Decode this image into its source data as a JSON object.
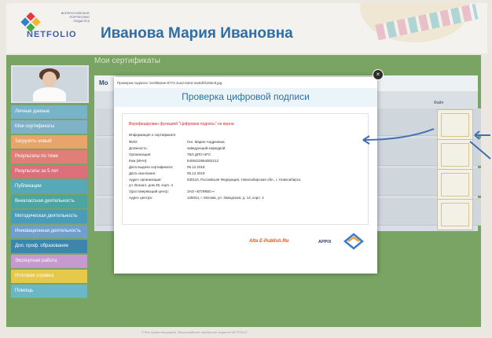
{
  "header": {
    "logo_line1": "ВСЕРОССИЙСКОЕ",
    "logo_line2": "ПОРТФОЛИО",
    "logo_line3": "ПЕДАГОГА",
    "logo_name": "NETFOLIO",
    "user_name": "Иванова Мария Ивановна"
  },
  "main_title": "Мои сертификаты",
  "content_header": "Мо",
  "sidebar": {
    "items": [
      {
        "label": "Личные данные",
        "color": "#78b4c9"
      },
      {
        "label": "Мои сертификаты",
        "color": "#7fb2c6"
      },
      {
        "label": "Загрузить новый",
        "color": "#e8a46a"
      },
      {
        "label": "Результаты по теме",
        "color": "#e07f78"
      },
      {
        "label": "Результаты за 5 лет",
        "color": "#dc6f7a"
      },
      {
        "label": "Публикации",
        "color": "#57a9b7"
      },
      {
        "label": "Внеклассная деятельность",
        "color": "#4aa5a3"
      },
      {
        "label": "Методическая деятельность",
        "color": "#4c9bb8"
      },
      {
        "label": "Инновационная деятельность",
        "color": "#6e9fd0"
      },
      {
        "label": "Доп. проф. образование",
        "color": "#3b86a9"
      },
      {
        "label": "Экспертная работа",
        "color": "#c69ad0"
      },
      {
        "label": "Итоговая справка",
        "color": "#e6c84a"
      },
      {
        "label": "Помощь",
        "color": "#6cb7c7"
      }
    ]
  },
  "thumbs_header": "Файл",
  "modal": {
    "path": "Проверка подписи: \\ec0b62ae-6774-4ca2-b4e2-4a3ebf11b5c8.jpg",
    "title": "Проверка цифровой подписи",
    "warning": "Верифицирован функцией \"Цифровая подпись\" не верна",
    "info_header": "Информация о сертификате",
    "rows": [
      {
        "k": "ФИО:",
        "v": "Ген. Мария Андреевна"
      },
      {
        "k": "Должность:",
        "v": "заведующий кафедрой"
      },
      {
        "k": "Организация:",
        "v": "ТБЛ ДПО НГО"
      },
      {
        "k": "Кем (ИНН):",
        "v": "5405422854002212"
      },
      {
        "k": "Дата выдачи сертификата:",
        "v": "05.12.2018"
      },
      {
        "k": "Дата окончания:",
        "v": "05.12.2019"
      },
      {
        "k": "Адрес организации:",
        "v": "630110, Российская Федерация, Новосибирская обл., г. Новосибирск,"
      },
      {
        "k": "ул. Вокзал, дом 25, корп. 4",
        "v": ""
      },
      {
        "k": "Удостоверяющий центр:",
        "v": "ЗАО «ЕГЛИБЕ»»"
      },
      {
        "k": "Адрес центра:",
        "v": "125044, г. Москва, ул. Заводская, д. 12, корп. 2"
      }
    ],
    "brand": "Alta E-Publish.Ru",
    "brand2": "APPIX",
    "close": "×"
  },
  "footer": "© Все права защищены. Всероссийское портфолио педагога NETFOLIO"
}
